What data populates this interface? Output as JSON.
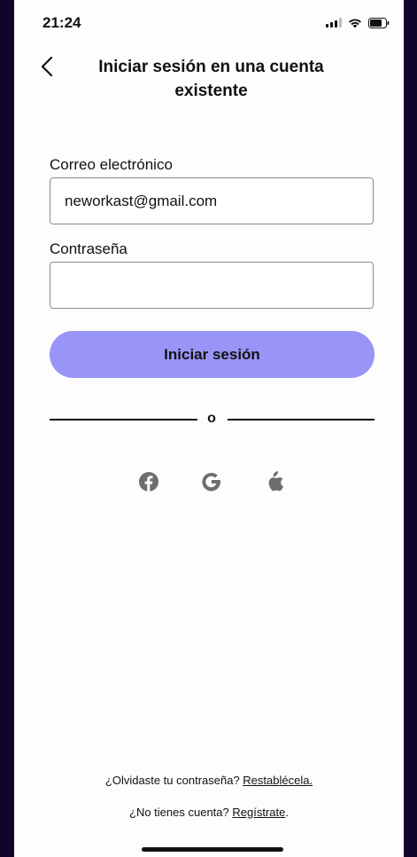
{
  "status_bar": {
    "time": "21:24"
  },
  "header": {
    "title": "Iniciar sesión en una cuenta existente"
  },
  "form": {
    "email_label": "Correo electrónico",
    "email_value": "neworkast@gmail.com",
    "password_label": "Contraseña",
    "password_value": "",
    "submit_label": "Iniciar sesión"
  },
  "divider": {
    "text": "o"
  },
  "social": {
    "icons": [
      "facebook-icon",
      "google-icon",
      "apple-icon"
    ],
    "icon_color": "#6e6e6e"
  },
  "footer": {
    "forgot_text": "¿Olvidaste tu contraseña?",
    "forgot_link": "Restablécela.",
    "register_text": "¿No tienes cuenta?",
    "register_link": "Regístrate",
    "register_suffix": "."
  },
  "colors": {
    "accent": "#9995f6",
    "frame": "#12052a",
    "background": "#fdfdfd"
  }
}
